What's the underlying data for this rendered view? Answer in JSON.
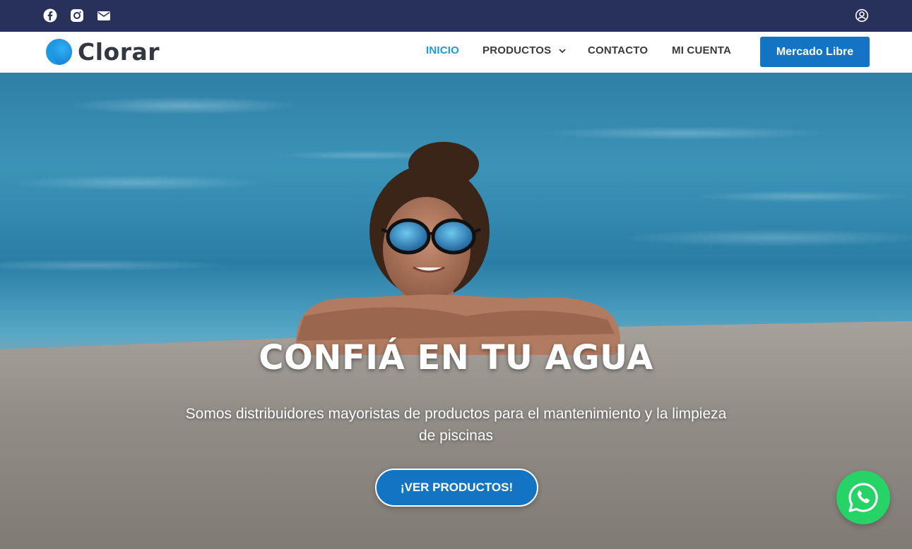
{
  "topbar": {
    "social_icons": [
      "facebook-icon",
      "instagram-icon",
      "email-icon"
    ],
    "account_icon": "user-icon",
    "background_color": "#28315a"
  },
  "brand": {
    "name": "Clorar",
    "color": "#1a9ae0"
  },
  "nav": {
    "items": [
      {
        "label": "INICIO",
        "active": true
      },
      {
        "label": "PRODUCTOS",
        "has_dropdown": true
      },
      {
        "label": "CONTACTO"
      },
      {
        "label": "MI CUENTA"
      }
    ],
    "cta_label": "Mercado Libre",
    "cta_color": "#1474c4"
  },
  "hero": {
    "title": "CONFIÁ EN TU AGUA",
    "subtitle": "Somos distribuidores mayoristas de productos para el mantenimiento y la limpieza de piscinas",
    "cta_label": "¡VER PRODUCTOS!"
  },
  "floating": {
    "whatsapp_icon": "whatsapp-icon",
    "color": "#25d366"
  }
}
